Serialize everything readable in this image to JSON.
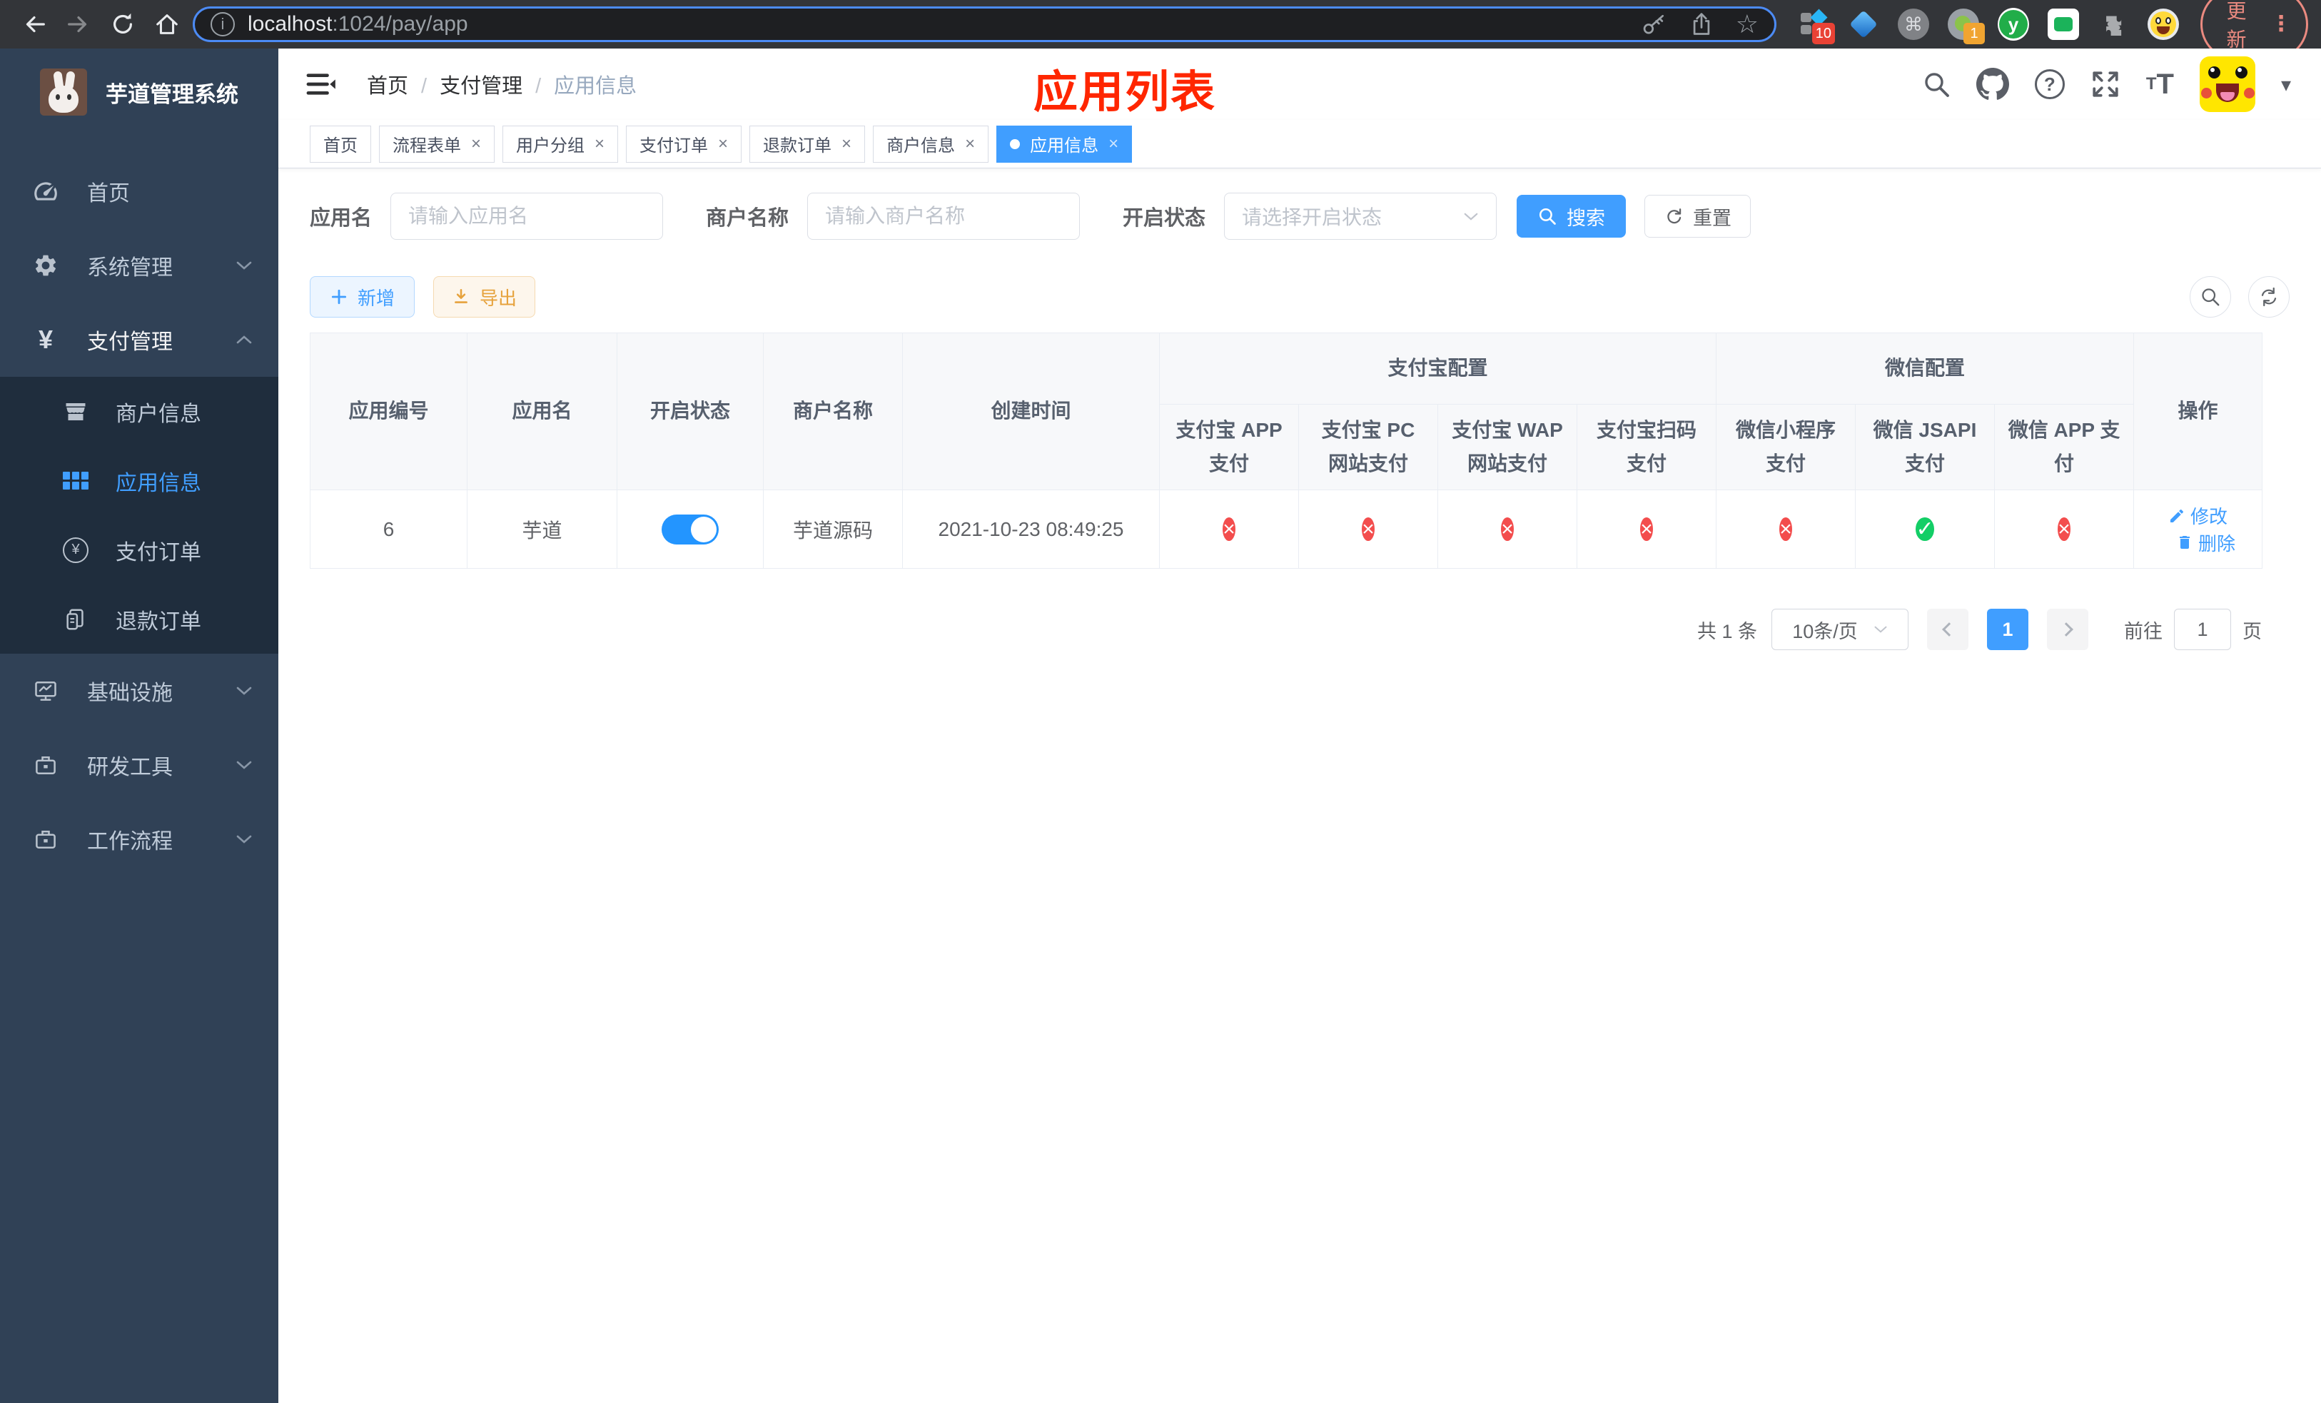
{
  "colors": {
    "accent": "#409eff",
    "success": "#13ce66",
    "danger": "#f34d4d",
    "warning": "#e6a23c",
    "sidebar_bg": "#304156",
    "submenu_bg": "#1f2d3d",
    "sidebar_text": "#bfcbd9"
  },
  "icons": {
    "yen": "¥",
    "star": "☆",
    "help": "?",
    "info": "i",
    "close": "×",
    "check": "✓",
    "cross": "×",
    "caret": "▾",
    "kebab": "⋮",
    "command": "⌘",
    "y_letter": "y"
  },
  "browser": {
    "url_host": "localhost",
    "url_path": ":1024/pay/app",
    "update_label": "更新",
    "ext_badge_1": "10",
    "ext_badge_2": "1"
  },
  "sidebar": {
    "title": "芋道管理系统",
    "items": [
      {
        "label": "首页"
      },
      {
        "label": "系统管理"
      },
      {
        "label": "支付管理"
      },
      {
        "label": "基础设施"
      },
      {
        "label": "研发工具"
      },
      {
        "label": "工作流程"
      }
    ],
    "submenu": [
      {
        "label": "商户信息"
      },
      {
        "label": "应用信息",
        "active": true
      },
      {
        "label": "支付订单"
      },
      {
        "label": "退款订单"
      }
    ]
  },
  "header": {
    "breadcrumb": [
      "首页",
      "支付管理",
      "应用信息"
    ],
    "overlay_title": "应用列表"
  },
  "tabs": [
    {
      "label": "首页",
      "closable": false,
      "active": false
    },
    {
      "label": "流程表单",
      "closable": true,
      "active": false
    },
    {
      "label": "用户分组",
      "closable": true,
      "active": false
    },
    {
      "label": "支付订单",
      "closable": true,
      "active": false
    },
    {
      "label": "退款订单",
      "closable": true,
      "active": false
    },
    {
      "label": "商户信息",
      "closable": true,
      "active": false
    },
    {
      "label": "应用信息",
      "closable": true,
      "active": true
    }
  ],
  "filters": {
    "app_name_label": "应用名",
    "app_name_placeholder": "请输入应用名",
    "merchant_label": "商户名称",
    "merchant_placeholder": "请输入商户名称",
    "status_label": "开启状态",
    "status_placeholder": "请选择开启状态",
    "search_label": "搜索",
    "reset_label": "重置"
  },
  "toolbar": {
    "add_label": "新增",
    "export_label": "导出"
  },
  "table": {
    "group_alipay": "支付宝配置",
    "group_wechat": "微信配置",
    "columns": [
      "应用编号",
      "应用名",
      "开启状态",
      "商户名称",
      "创建时间",
      "支付宝 APP 支付",
      "支付宝 PC 网站支付",
      "支付宝 WAP 网站支付",
      "支付宝扫码支付",
      "微信小程序支付",
      "微信 JSAPI 支付",
      "微信 APP 支付",
      "操作"
    ],
    "row": {
      "id": "6",
      "name": "芋道",
      "enabled": true,
      "merchant": "芋道源码",
      "created": "2021-10-23 08:49:25",
      "channels": [
        false,
        false,
        false,
        false,
        false,
        true,
        false
      ],
      "edit_label": "修改",
      "delete_label": "删除"
    }
  },
  "pagination": {
    "total": "共 1 条",
    "page_size": "10条/页",
    "page": "1",
    "goto_label": "前往",
    "goto_value": "1",
    "goto_unit": "页"
  }
}
